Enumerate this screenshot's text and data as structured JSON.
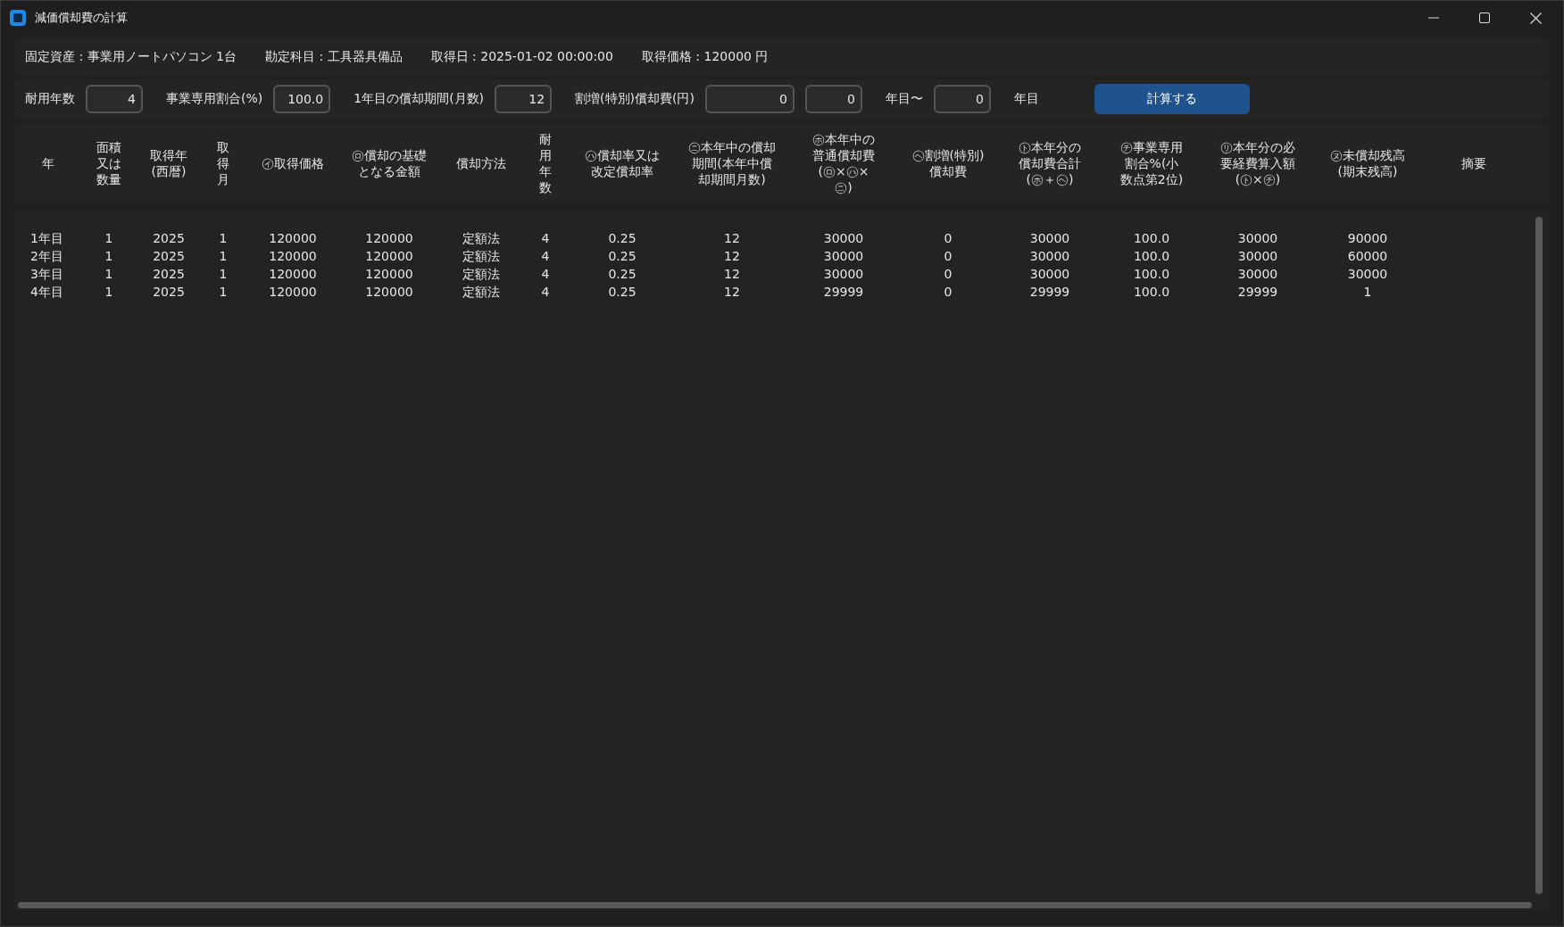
{
  "window": {
    "title": "減価償却費の計算"
  },
  "info": [
    "固定資産 : 事業用ノートパソコン 1台",
    "勘定科目 : 工具器具備品",
    "取得日 : 2025-01-02 00:00:00",
    "取得価格 : 120000 円"
  ],
  "controls": [
    {
      "kind": "label",
      "text": "耐用年数"
    },
    {
      "kind": "input",
      "value": "4"
    },
    {
      "kind": "label",
      "text": "事業専用割合(%)"
    },
    {
      "kind": "input",
      "value": "100.0"
    },
    {
      "kind": "label",
      "text": "1年目の償却期間(月数)"
    },
    {
      "kind": "input",
      "value": "12"
    },
    {
      "kind": "label",
      "text": "割増(特別)償却費(円)"
    },
    {
      "kind": "wide_input",
      "value": "0"
    },
    {
      "kind": "input",
      "value": "0"
    },
    {
      "kind": "label",
      "text": "年目〜"
    },
    {
      "kind": "input",
      "value": "0"
    },
    {
      "kind": "label",
      "text": "年目"
    },
    {
      "kind": "button",
      "text": "計算する"
    }
  ],
  "table": {
    "columns": [
      "年",
      "面積又は数量",
      "取得年(西暦)",
      "取得月",
      "㋑取得価格",
      "㋺償却の基礎となる金額",
      "償却方法",
      "耐用年数",
      "㋩償却率又は改定償却率",
      "㋥本年中の償却期間(本年中償却期間月数)",
      "㋭本年中の普通償却費(㋺×㋩×㋥)",
      "㋬割増(特別)償却費",
      "㋣本年分の償却費合計(㋭＋㋬)",
      "㋠事業専用割合%(小数点第2位)",
      "㋷本年分の必要経費算入額(㋣×㋠)",
      "㋦未償却残高(期末残高)",
      "摘要"
    ],
    "rows": [
      [
        "1年目",
        "1",
        "2025",
        "1",
        "120000",
        "120000",
        "定額法",
        "4",
        "0.25",
        "12",
        "30000",
        "0",
        "30000",
        "100.0",
        "30000",
        "90000",
        ""
      ],
      [
        "2年目",
        "1",
        "2025",
        "1",
        "120000",
        "120000",
        "定額法",
        "4",
        "0.25",
        "12",
        "30000",
        "0",
        "30000",
        "100.0",
        "30000",
        "60000",
        ""
      ],
      [
        "3年目",
        "1",
        "2025",
        "1",
        "120000",
        "120000",
        "定額法",
        "4",
        "0.25",
        "12",
        "30000",
        "0",
        "30000",
        "100.0",
        "30000",
        "30000",
        ""
      ],
      [
        "4年目",
        "1",
        "2025",
        "1",
        "120000",
        "120000",
        "定額法",
        "4",
        "0.25",
        "12",
        "29999",
        "0",
        "29999",
        "100.0",
        "29999",
        "1",
        ""
      ]
    ]
  }
}
